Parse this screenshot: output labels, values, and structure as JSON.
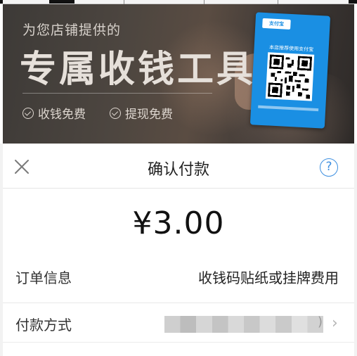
{
  "banner": {
    "subtitle": "为您店铺提供的",
    "title": "专属收钱工具",
    "features": [
      "收钱免费",
      "提现免费"
    ],
    "sign": {
      "logo_text": "支付宝",
      "hint": "本店推荐使用支付宝"
    }
  },
  "sheet": {
    "title": "确认付款",
    "help_label": "?",
    "amount": "¥3.00",
    "order_label": "订单信息",
    "order_value": "收钱码贴纸或挂牌费用",
    "pay_label": "付款方式",
    "pay_method_tail": ")",
    "chevron": "›"
  },
  "colors": {
    "accent_blue": "#3d8fe0",
    "sign_blue": "#1a8fe3"
  }
}
